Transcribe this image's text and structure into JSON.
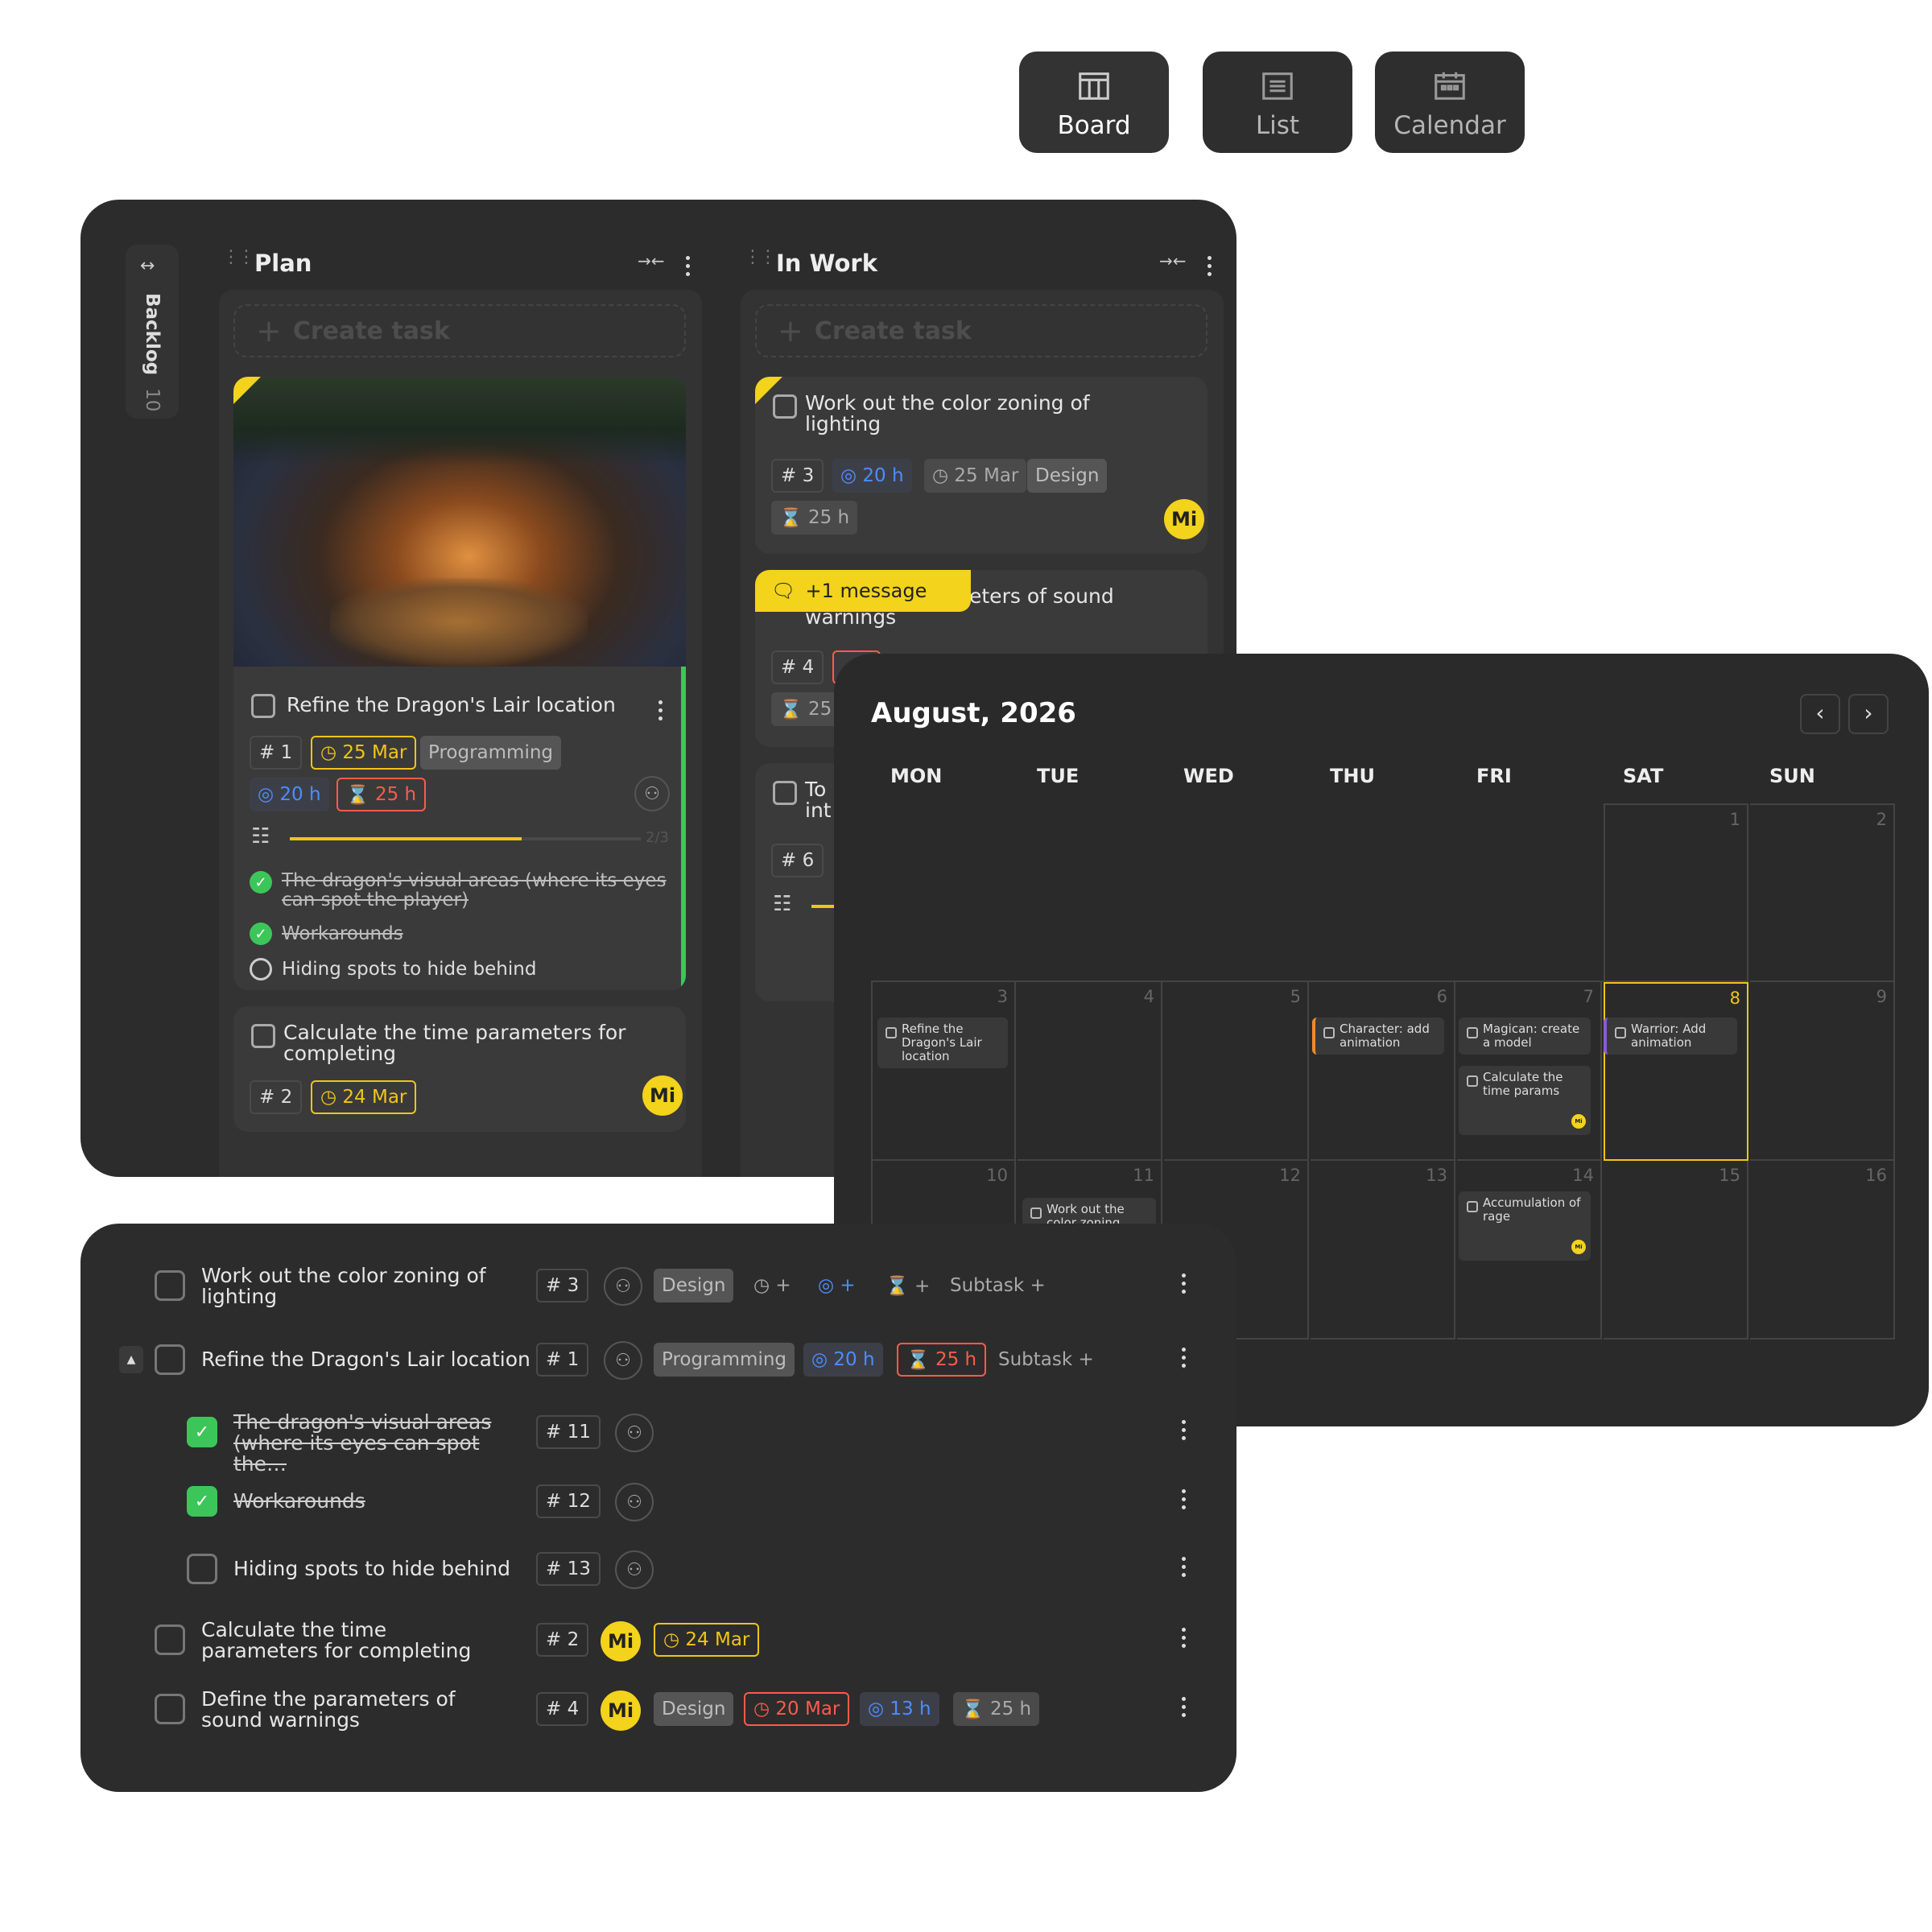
{
  "views": [
    {
      "label": "Board",
      "icon": "board-icon"
    },
    {
      "label": "List",
      "icon": "list-icon"
    },
    {
      "label": "Calendar",
      "icon": "calendar-icon"
    }
  ],
  "board": {
    "backlog": {
      "label": "Backlog",
      "count": "10"
    },
    "columns": [
      {
        "title": "Plan",
        "create": "Create task"
      },
      {
        "title": "In Work",
        "create": "Create task"
      }
    ],
    "plan_cards": [
      {
        "title": "Refine the Dragon's Lair location",
        "num": "# 1",
        "date": "25 Mar",
        "category": "Programming",
        "estimate": "20 h",
        "spent": "25 h",
        "progress_label": "2/3",
        "progress": 0.66,
        "subtasks": [
          {
            "text": "The dragon's visual areas (where its eyes can spot the player)",
            "done": true
          },
          {
            "text": "Workarounds",
            "done": true
          },
          {
            "text": "Hiding spots to hide behind",
            "done": false
          }
        ]
      },
      {
        "title": "Calculate the time parameters for completing",
        "num": "# 2",
        "date": "24 Mar",
        "avatar": "Mi"
      }
    ],
    "work_cards": [
      {
        "title": "Work out the color zoning of lighting",
        "num": "# 3",
        "estimate": "20 h",
        "date": "25 Mar",
        "category": "Design",
        "spent": "25 h",
        "avatar": "Mi"
      },
      {
        "title_tail": "eters of sound",
        "title_line2": "warnings",
        "message": "+1 message",
        "num": "# 4",
        "spent": "25"
      },
      {
        "title": "To",
        "title_line2": "int",
        "num": "# 6"
      }
    ]
  },
  "calendar": {
    "month": "August, 2026",
    "weekdays": [
      "MON",
      "TUE",
      "WED",
      "THU",
      "FRI",
      "SAT",
      "SUN"
    ],
    "rows": [
      [
        "",
        "",
        "",
        "",
        "",
        "1",
        "2"
      ],
      [
        "3",
        "4",
        "5",
        "6",
        "7",
        "8",
        "9"
      ],
      [
        "10",
        "11",
        "12",
        "13",
        "14",
        "15",
        "16"
      ]
    ],
    "today": "8",
    "events": [
      {
        "text": "Refine the Dragon's Lair location"
      },
      {
        "text": "Character: add animation"
      },
      {
        "text": "Magican: create a model"
      },
      {
        "text": "Calculate the time params",
        "avatar": "Mi"
      },
      {
        "text": "Warrior: Add animation"
      },
      {
        "text": "Work out the color zoning"
      },
      {
        "text": "Accumulation of rage",
        "avatar": "Mi"
      }
    ]
  },
  "list": {
    "rows": [
      {
        "title": "Work out the color zoning of lighting",
        "num": "# 3",
        "category": "Design",
        "estimate": "+",
        "spent": "+",
        "date": "+",
        "subtask": "Subtask +"
      },
      {
        "title": "Refine the Dragon's Lair location",
        "num": "# 1",
        "category": "Programming",
        "estimate": "20 h",
        "spent": "25 h",
        "subtask": "Subtask +"
      },
      {
        "title": "The dragon's visual areas (where its eyes can spot the…",
        "num": "# 11"
      },
      {
        "title": "Workarounds",
        "num": "# 12"
      },
      {
        "title": "Hiding spots to hide behind",
        "num": "# 13"
      },
      {
        "title": "Calculate the time parameters for completing",
        "num": "# 2",
        "avatar": "Mi",
        "date": "24 Mar"
      },
      {
        "title": "Define the parameters of sound warnings",
        "num": "# 4",
        "avatar": "Mi",
        "category": "Design",
        "date": "20 Mar",
        "estimate": "13 h",
        "spent": "25 h"
      }
    ]
  }
}
